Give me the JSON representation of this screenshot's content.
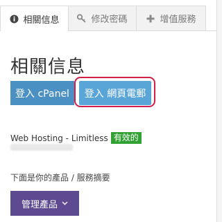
{
  "tabs": [
    {
      "label": "相關信息",
      "icon": "info-icon",
      "active": true
    },
    {
      "label": "修改密碼",
      "icon": "key-icon",
      "active": false
    },
    {
      "label": "增值服務",
      "icon": "plus-icon",
      "active": false
    }
  ],
  "page": {
    "title": "相關信息"
  },
  "buttons": {
    "cpanel_login": "登入 cPanel",
    "webmail_login": "登入 網頁電郵",
    "manage_product": "管理產品"
  },
  "product": {
    "name": "Web Hosting - Limitless",
    "status": "有效的"
  },
  "summary_text": "下面是你的產品 / 服務摘要",
  "colors": {
    "cpanel_button": "#4a90c2",
    "webmail_button": "#5aa5d8",
    "highlight_border": "#d21e48",
    "status_badge": "#31a134",
    "manage_button": "#5d4a91"
  }
}
